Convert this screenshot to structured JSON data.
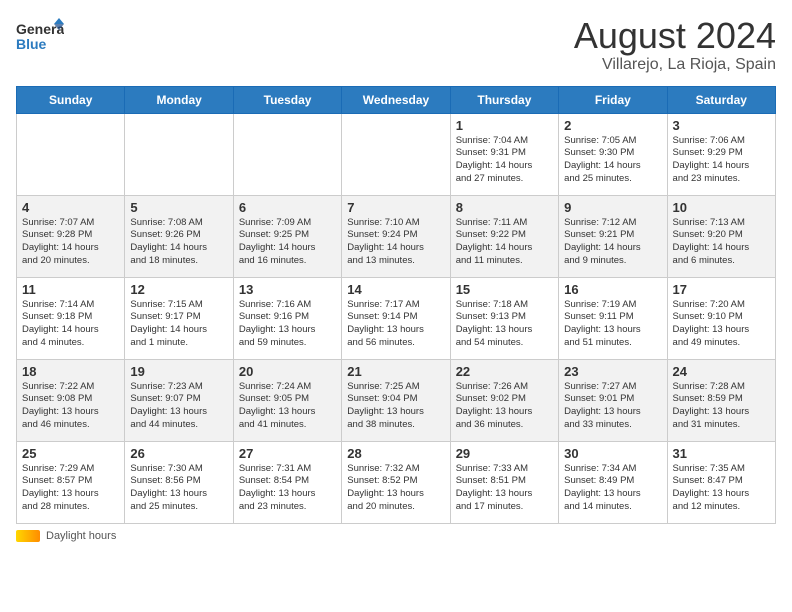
{
  "header": {
    "logo_general": "General",
    "logo_blue": "Blue",
    "title": "August 2024",
    "subtitle": "Villarejo, La Rioja, Spain"
  },
  "days_of_week": [
    "Sunday",
    "Monday",
    "Tuesday",
    "Wednesday",
    "Thursday",
    "Friday",
    "Saturday"
  ],
  "weeks": [
    [
      {
        "day": "",
        "content": ""
      },
      {
        "day": "",
        "content": ""
      },
      {
        "day": "",
        "content": ""
      },
      {
        "day": "",
        "content": ""
      },
      {
        "day": "1",
        "content": "Sunrise: 7:04 AM\nSunset: 9:31 PM\nDaylight: 14 hours\nand 27 minutes."
      },
      {
        "day": "2",
        "content": "Sunrise: 7:05 AM\nSunset: 9:30 PM\nDaylight: 14 hours\nand 25 minutes."
      },
      {
        "day": "3",
        "content": "Sunrise: 7:06 AM\nSunset: 9:29 PM\nDaylight: 14 hours\nand 23 minutes."
      }
    ],
    [
      {
        "day": "4",
        "content": "Sunrise: 7:07 AM\nSunset: 9:28 PM\nDaylight: 14 hours\nand 20 minutes."
      },
      {
        "day": "5",
        "content": "Sunrise: 7:08 AM\nSunset: 9:26 PM\nDaylight: 14 hours\nand 18 minutes."
      },
      {
        "day": "6",
        "content": "Sunrise: 7:09 AM\nSunset: 9:25 PM\nDaylight: 14 hours\nand 16 minutes."
      },
      {
        "day": "7",
        "content": "Sunrise: 7:10 AM\nSunset: 9:24 PM\nDaylight: 14 hours\nand 13 minutes."
      },
      {
        "day": "8",
        "content": "Sunrise: 7:11 AM\nSunset: 9:22 PM\nDaylight: 14 hours\nand 11 minutes."
      },
      {
        "day": "9",
        "content": "Sunrise: 7:12 AM\nSunset: 9:21 PM\nDaylight: 14 hours\nand 9 minutes."
      },
      {
        "day": "10",
        "content": "Sunrise: 7:13 AM\nSunset: 9:20 PM\nDaylight: 14 hours\nand 6 minutes."
      }
    ],
    [
      {
        "day": "11",
        "content": "Sunrise: 7:14 AM\nSunset: 9:18 PM\nDaylight: 14 hours\nand 4 minutes."
      },
      {
        "day": "12",
        "content": "Sunrise: 7:15 AM\nSunset: 9:17 PM\nDaylight: 14 hours\nand 1 minute."
      },
      {
        "day": "13",
        "content": "Sunrise: 7:16 AM\nSunset: 9:16 PM\nDaylight: 13 hours\nand 59 minutes."
      },
      {
        "day": "14",
        "content": "Sunrise: 7:17 AM\nSunset: 9:14 PM\nDaylight: 13 hours\nand 56 minutes."
      },
      {
        "day": "15",
        "content": "Sunrise: 7:18 AM\nSunset: 9:13 PM\nDaylight: 13 hours\nand 54 minutes."
      },
      {
        "day": "16",
        "content": "Sunrise: 7:19 AM\nSunset: 9:11 PM\nDaylight: 13 hours\nand 51 minutes."
      },
      {
        "day": "17",
        "content": "Sunrise: 7:20 AM\nSunset: 9:10 PM\nDaylight: 13 hours\nand 49 minutes."
      }
    ],
    [
      {
        "day": "18",
        "content": "Sunrise: 7:22 AM\nSunset: 9:08 PM\nDaylight: 13 hours\nand 46 minutes."
      },
      {
        "day": "19",
        "content": "Sunrise: 7:23 AM\nSunset: 9:07 PM\nDaylight: 13 hours\nand 44 minutes."
      },
      {
        "day": "20",
        "content": "Sunrise: 7:24 AM\nSunset: 9:05 PM\nDaylight: 13 hours\nand 41 minutes."
      },
      {
        "day": "21",
        "content": "Sunrise: 7:25 AM\nSunset: 9:04 PM\nDaylight: 13 hours\nand 38 minutes."
      },
      {
        "day": "22",
        "content": "Sunrise: 7:26 AM\nSunset: 9:02 PM\nDaylight: 13 hours\nand 36 minutes."
      },
      {
        "day": "23",
        "content": "Sunrise: 7:27 AM\nSunset: 9:01 PM\nDaylight: 13 hours\nand 33 minutes."
      },
      {
        "day": "24",
        "content": "Sunrise: 7:28 AM\nSunset: 8:59 PM\nDaylight: 13 hours\nand 31 minutes."
      }
    ],
    [
      {
        "day": "25",
        "content": "Sunrise: 7:29 AM\nSunset: 8:57 PM\nDaylight: 13 hours\nand 28 minutes."
      },
      {
        "day": "26",
        "content": "Sunrise: 7:30 AM\nSunset: 8:56 PM\nDaylight: 13 hours\nand 25 minutes."
      },
      {
        "day": "27",
        "content": "Sunrise: 7:31 AM\nSunset: 8:54 PM\nDaylight: 13 hours\nand 23 minutes."
      },
      {
        "day": "28",
        "content": "Sunrise: 7:32 AM\nSunset: 8:52 PM\nDaylight: 13 hours\nand 20 minutes."
      },
      {
        "day": "29",
        "content": "Sunrise: 7:33 AM\nSunset: 8:51 PM\nDaylight: 13 hours\nand 17 minutes."
      },
      {
        "day": "30",
        "content": "Sunrise: 7:34 AM\nSunset: 8:49 PM\nDaylight: 13 hours\nand 14 minutes."
      },
      {
        "day": "31",
        "content": "Sunrise: 7:35 AM\nSunset: 8:47 PM\nDaylight: 13 hours\nand 12 minutes."
      }
    ]
  ],
  "footer": {
    "daylight_label": "Daylight hours"
  }
}
